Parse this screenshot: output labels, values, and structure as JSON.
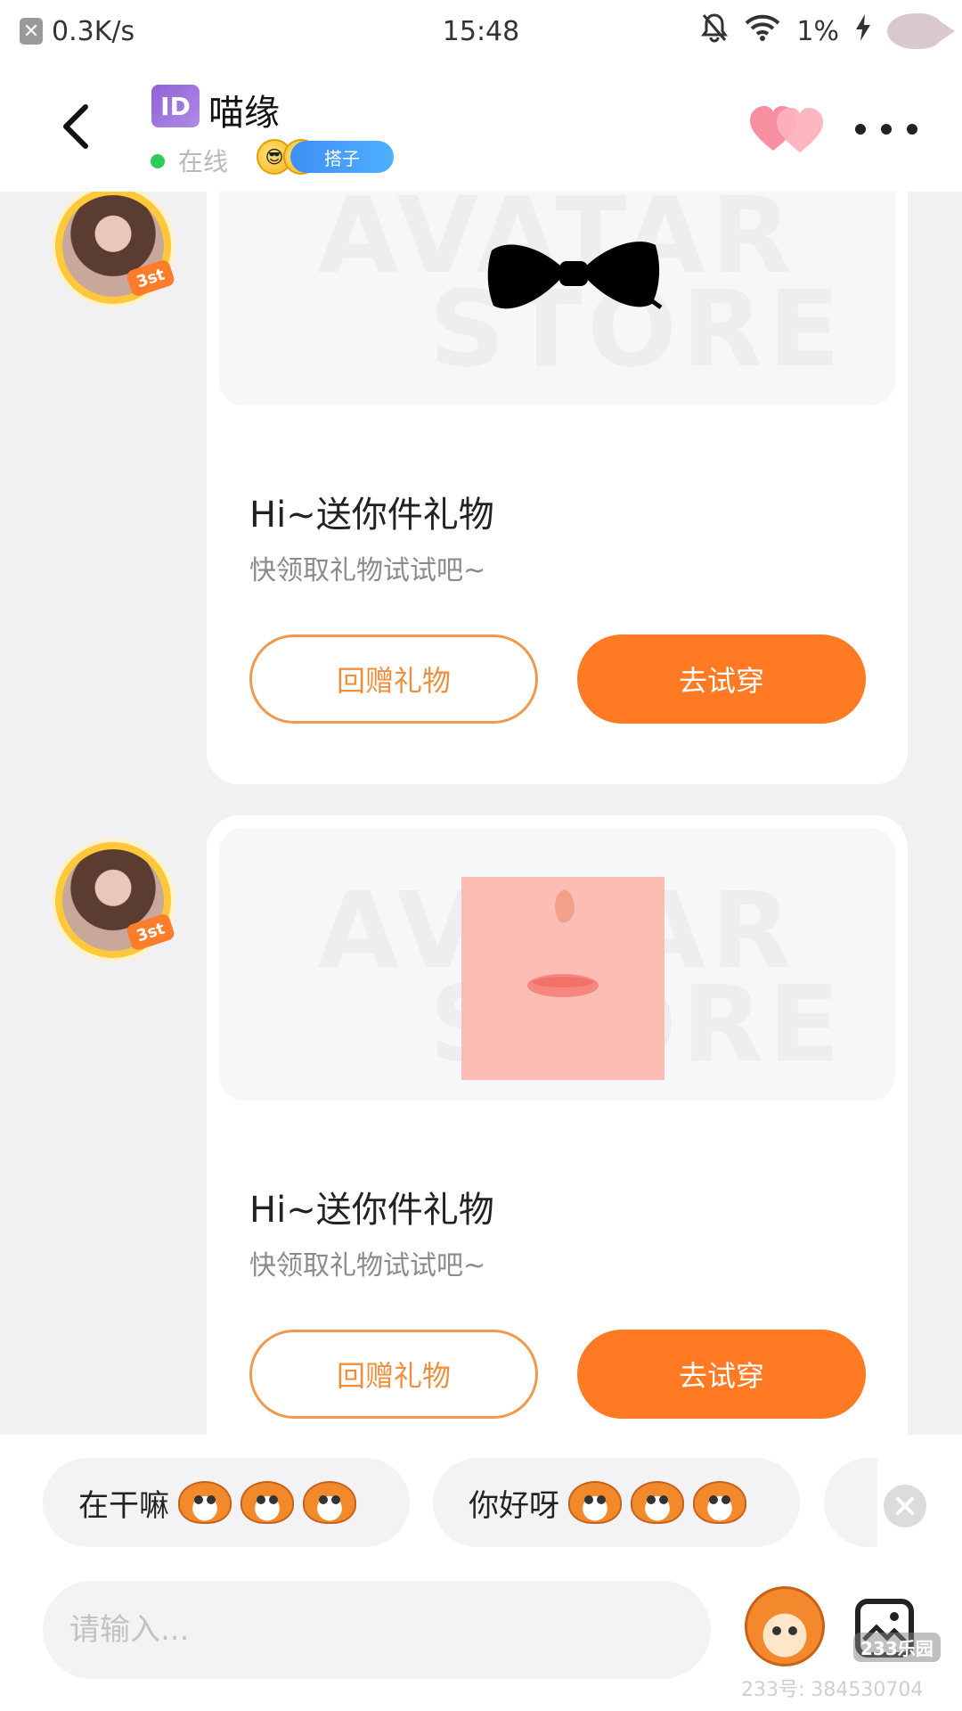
{
  "status_bar": {
    "speed": "0.3K/s",
    "time": "15:48",
    "battery": "1%"
  },
  "header": {
    "id_badge": "ID",
    "name": "喵缘",
    "status": "在线",
    "tag": "搭子"
  },
  "messages": [
    {
      "image_watermark_top": "AVATAR",
      "image_watermark_bottom": "STORE",
      "item": "bow-tie",
      "title": "Hi~送你件礼物",
      "subtitle": "快领取礼物试试吧~",
      "secondary_button": "回赠礼物",
      "primary_button": "去试穿",
      "avatar_badge": "3st"
    },
    {
      "image_watermark_top": "AVATAR",
      "image_watermark_bottom": "STORE",
      "item": "face-makeup",
      "title": "Hi~送你件礼物",
      "subtitle": "快领取礼物试试吧~",
      "secondary_button": "回赠礼物",
      "primary_button": "去试穿",
      "avatar_badge": "3st"
    }
  ],
  "quick_replies": [
    {
      "text": "在干嘛"
    },
    {
      "text": "你好呀"
    }
  ],
  "input": {
    "placeholder": "请输入..."
  },
  "watermark": {
    "brand": "233乐园",
    "id": "233号: 384530704"
  },
  "colors": {
    "accent": "#ff7a22",
    "outline": "#f0994c",
    "online": "#2ecc5a",
    "id_badge": "#8d63d6"
  }
}
